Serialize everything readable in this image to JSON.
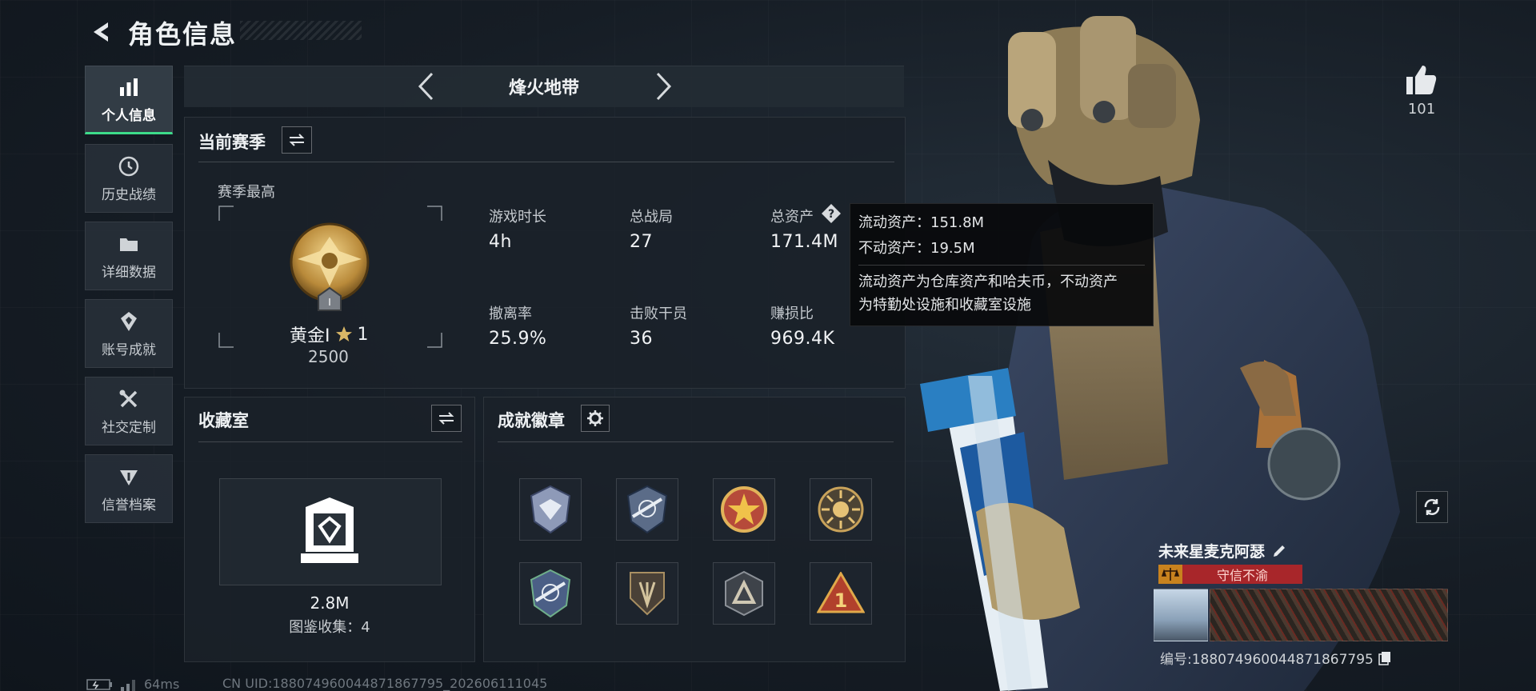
{
  "header": {
    "title": "角色信息"
  },
  "sidebar": {
    "items": [
      {
        "label": "个人信息",
        "icon": "bar-chart-icon",
        "active": true
      },
      {
        "label": "历史战绩",
        "icon": "history-icon",
        "active": false
      },
      {
        "label": "详细数据",
        "icon": "folder-icon",
        "active": false
      },
      {
        "label": "账号成就",
        "icon": "achievement-icon",
        "active": false
      },
      {
        "label": "社交定制",
        "icon": "tools-icon",
        "active": false
      },
      {
        "label": "信誉档案",
        "icon": "credit-icon",
        "active": false
      }
    ]
  },
  "mode": {
    "title": "烽火地带"
  },
  "season": {
    "title": "当前赛季",
    "best_label": "赛季最高",
    "rank_name": "黄金I",
    "rank_stars": "1",
    "rank_score": "2500",
    "stats": [
      {
        "label": "游戏时长",
        "value": "4h"
      },
      {
        "label": "总战局",
        "value": "27"
      },
      {
        "label": "总资产",
        "value": "171.4M"
      },
      {
        "label": "撤离率",
        "value": "25.9%"
      },
      {
        "label": "击败干员",
        "value": "36"
      },
      {
        "label": "赚损比",
        "value": "969.4K"
      }
    ]
  },
  "tooltip": {
    "liquid": "流动资产：151.8M",
    "fixed": "不动资产：19.5M",
    "desc_line1": "流动资产为仓库资产和哈夫币，不动资产",
    "desc_line2": "为特勤处设施和收藏室设施"
  },
  "collection": {
    "title": "收藏室",
    "value": "2.8M",
    "catalog": "图鉴收集：4"
  },
  "achievements": {
    "title": "成就徽章",
    "badges": [
      "eagle-badge-icon",
      "rifle-badge-icon",
      "star-badge-icon",
      "sun-badge-icon",
      "rifle-badge-2-icon",
      "shield-badge-icon",
      "triangle-badge-icon",
      "number-one-badge-icon"
    ]
  },
  "likes": {
    "count": "101"
  },
  "player": {
    "name": "未来星麦克阿瑟",
    "title_badge": "守信不渝",
    "id_text": "编号:1880749600448718677​95"
  },
  "status": {
    "ping": "64ms",
    "uid": "CN UID:1880749600448718677​95_202606111045"
  },
  "colors": {
    "accent_green": "#3ddc8a",
    "title_badge_red": "#a8262a",
    "gold": "#c9a14a"
  }
}
